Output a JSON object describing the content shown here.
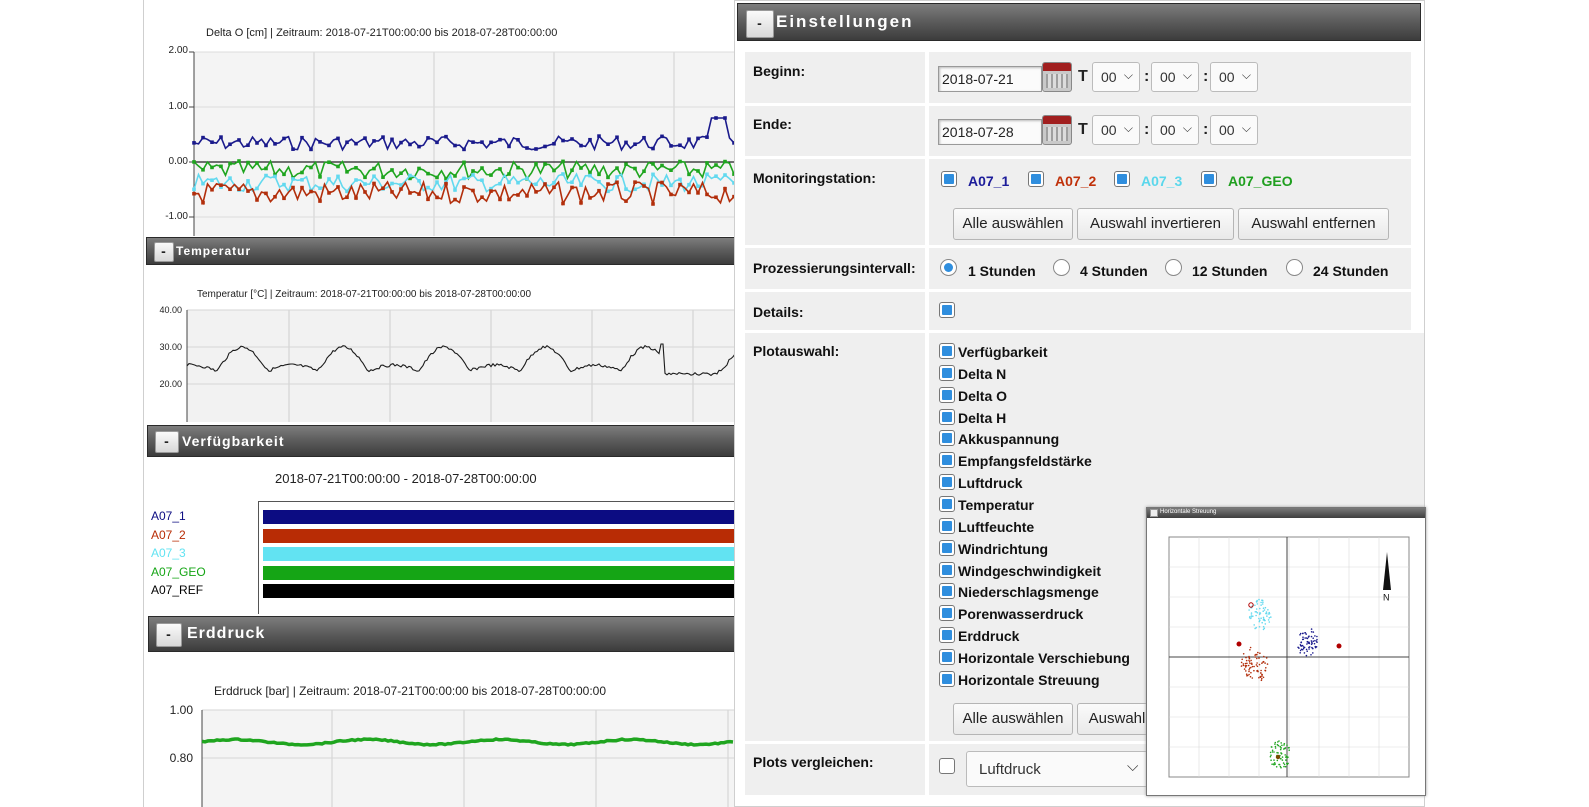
{
  "delta_o": {
    "title": "Delta O [cm] | Zeitraum: 2018-07-21T00:00:00 bis 2018-07-28T00:00:00",
    "yticks": [
      "2.00",
      "1.00",
      "0.00",
      "-1.00"
    ],
    "series_colors": {
      "A07_1": "#1a1a8c",
      "A07_2": "#b22e0b",
      "A07_3": "#62d9ef",
      "A07_GEO": "#1fa51f"
    }
  },
  "temperatur": {
    "header": "Temperatur",
    "title": "Temperatur [°C] | Zeitraum: 2018-07-21T00:00:00 bis 2018-07-28T00:00:00",
    "yticks": [
      "40.00",
      "30.00",
      "20.00"
    ]
  },
  "verfuegbarkeit": {
    "header": "Verfügbarkeit",
    "title": "2018-07-21T00:00:00 - 2018-07-28T00:00:00",
    "stations": [
      {
        "label": "A07_1",
        "color": "#0c0c82"
      },
      {
        "label": "A07_2",
        "color": "#b82c05"
      },
      {
        "label": "A07_3",
        "color": "#62e3f2"
      },
      {
        "label": "A07_GEO",
        "color": "#15a515"
      },
      {
        "label": "A07_REF",
        "color": "#000000"
      }
    ]
  },
  "erddruck": {
    "header": "Erddruck",
    "title": "Erddruck [bar] | Zeitraum: 2018-07-21T00:00:00 bis 2018-07-28T00:00:00",
    "yticks": [
      "1.00",
      "0.80"
    ]
  },
  "settings": {
    "header": "Einstellungen",
    "toggle": "-",
    "beginn": {
      "label": "Beginn:",
      "date": "2018-07-21",
      "t": "T",
      "h": "00",
      "m": "00",
      "s": "00"
    },
    "ende": {
      "label": "Ende:",
      "date": "2018-07-28",
      "t": "T",
      "h": "00",
      "m": "00",
      "s": "00"
    },
    "colon": ":",
    "monitoring": {
      "label": "Monitoringstation:",
      "stations": [
        {
          "label": "A07_1",
          "color": "#1c1c9a"
        },
        {
          "label": "A07_2",
          "color": "#c0310a"
        },
        {
          "label": "A07_3",
          "color": "#5ad7ec"
        },
        {
          "label": "A07_GEO",
          "color": "#1f9f1f"
        }
      ],
      "buttons": [
        "Alle auswählen",
        "Auswahl invertieren",
        "Auswahl entfernen"
      ]
    },
    "intervall": {
      "label": "Prozessierungsintervall:",
      "options": [
        "1 Stunden",
        "4 Stunden",
        "12 Stunden",
        "24 Stunden"
      ],
      "selected": 0
    },
    "details": {
      "label": "Details:"
    },
    "plotauswahl": {
      "label": "Plotauswahl:",
      "items": [
        "Verfügbarkeit",
        "Delta N",
        "Delta O",
        "Delta H",
        "Akkuspannung",
        "Empfangsfeldstärke",
        "Luftdruck",
        "Temperatur",
        "Luftfeuchte",
        "Windrichtung",
        "Windgeschwindigkeit",
        "Niederschlagsmenge",
        "Porenwasserdruck",
        "Erddruck",
        "Horizontale Verschiebung",
        "Horizontale Streuung"
      ],
      "buttons": [
        "Alle auswählen",
        "Auswahl"
      ]
    },
    "vergleichen": {
      "label": "Plots vergleichen:",
      "select": "Luftdruck"
    }
  },
  "streuung": {
    "title": "Horizontale Streuung",
    "north": "N",
    "cluster_colors": [
      "#62d9ef",
      "#1a1a8c",
      "#b22e0b",
      "#1fa51f"
    ]
  }
}
